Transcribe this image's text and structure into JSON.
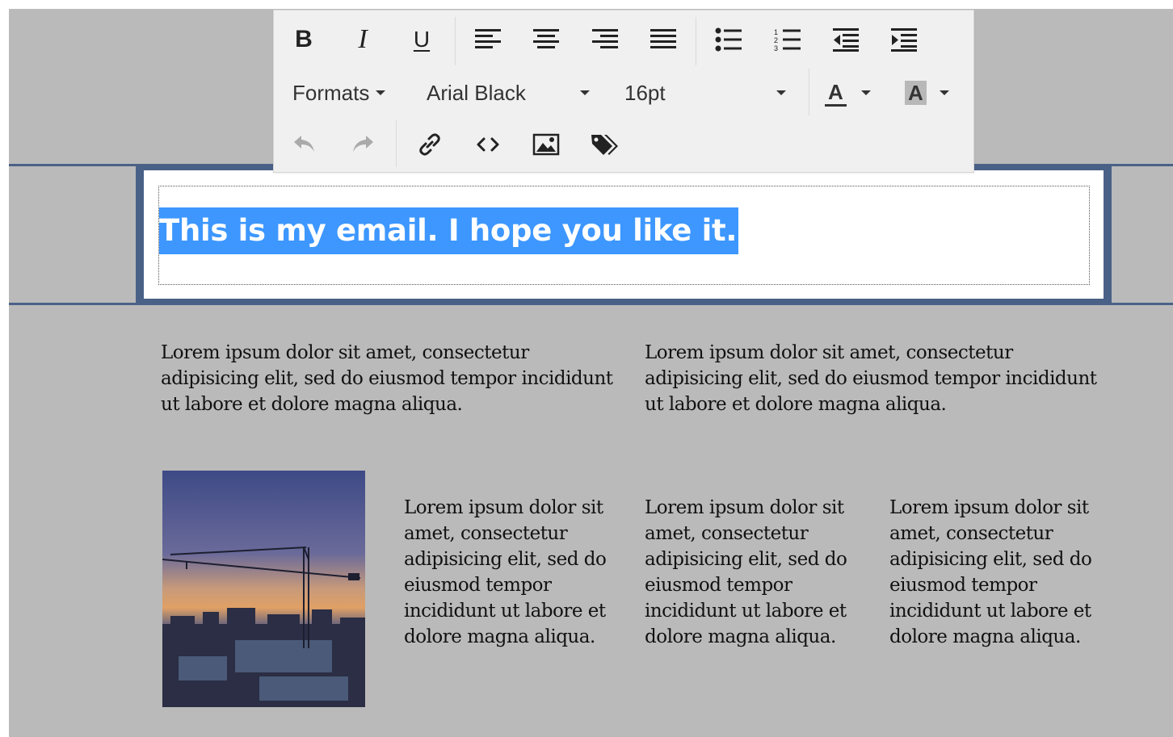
{
  "toolbar": {
    "row1": {
      "bold": "B",
      "italic": "I",
      "underline": "U",
      "icons": [
        "align-left-icon",
        "align-center-icon",
        "align-right-icon",
        "align-justify-icon",
        "bullet-list-icon",
        "numbered-list-icon",
        "outdent-icon",
        "indent-icon"
      ]
    },
    "row2": {
      "formats_label": "Formats",
      "font_family_value": "Arial Black",
      "font_size_value": "16pt",
      "text_color_glyph": "A",
      "background_color_glyph": "A"
    },
    "row3": {
      "icons": [
        "undo-icon",
        "redo-icon",
        "link-icon",
        "source-code-icon",
        "image-icon",
        "tags-icon"
      ]
    }
  },
  "email": {
    "header_text": "This is my email. I hope you like it.",
    "paragraph_left": "Lorem ipsum dolor sit amet, consectetur adipisicing elit, sed do eiusmod tempor incididunt ut labore et dolore magna aliqua.",
    "paragraph_right": "Lorem ipsum dolor sit amet, consectetur adipisicing elit, sed do eiusmod tempor incididunt ut labore et dolore magna aliqua.",
    "column_texts": [
      "Lorem ipsum dolor sit amet, consectetur adipisicing elit, sed do eiusmod tempor incididunt ut labore et dolore magna aliqua.",
      "Lorem ipsum dolor sit amet, consectetur adipisicing elit, sed do eiusmod tempor incididunt ut labore et dolore magna aliqua.",
      "Lorem ipsum dolor sit amet, consectetur adipisicing elit, sed do eiusmod tempor incididunt ut labore et dolore magna aliqua."
    ],
    "image_icon": "construction-crane-photo"
  },
  "colors": {
    "canvas_bg": "#bababa",
    "header_border": "#4a6187",
    "selection_highlight": "#3d97ff",
    "toolbar_bg": "#f0f0f0"
  }
}
